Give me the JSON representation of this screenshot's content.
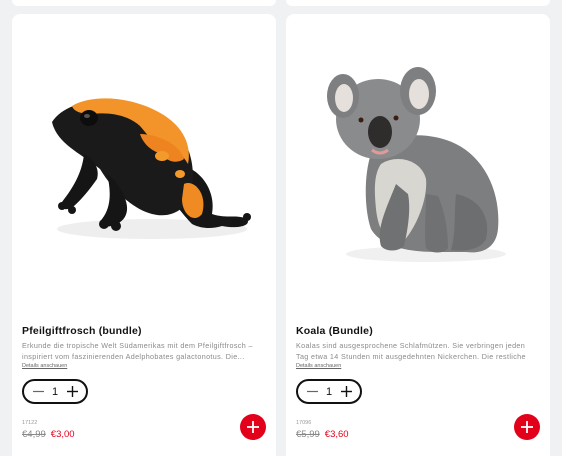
{
  "products": [
    {
      "title": "Pfeilgiftfrosch (bundle)",
      "description": "Erkunde die tropische Welt Südamerikas mit dem Pfeilgiftfrosch – inspiriert vom faszinierenden Adelphobates galactonotus. Die...",
      "details_link": "Details anschauen",
      "quantity": "1",
      "sku": "17122",
      "old_price": "€4,99",
      "new_price": "€3,00",
      "image_icon": "poison-dart-frog-figure"
    },
    {
      "title": "Koala (Bundle)",
      "description": "Koalas sind ausgesprochene Schlafmützen. Sie verbringen jeden Tag etwa 14 Stunden mit ausgedehnten Nickerchen. Die restliche Zeit ...",
      "details_link": "Details anschauen",
      "quantity": "1",
      "sku": "17096",
      "old_price": "€5,99",
      "new_price": "€3,60",
      "image_icon": "koala-figure"
    }
  ],
  "colors": {
    "accent": "#e2001a",
    "background": "#f0f1f2"
  }
}
